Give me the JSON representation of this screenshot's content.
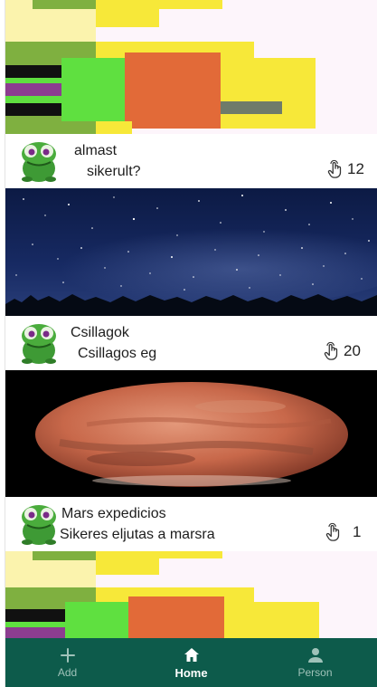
{
  "posts": [
    {
      "title": "almast",
      "body": "sikerult?",
      "likes": "12",
      "image": "abstract-blocks"
    },
    {
      "title": "Csillagok",
      "body": "Csillagos eg",
      "likes": "20",
      "image": "starry-sky"
    },
    {
      "title": "Mars expedicios",
      "body": "Sikeres eljutas a marsra",
      "likes": "1",
      "image": "mars-planet"
    }
  ],
  "nav": {
    "items": [
      {
        "label": "Add",
        "icon": "plus-icon"
      },
      {
        "label": "Home",
        "icon": "home-icon",
        "active": true
      },
      {
        "label": "Person",
        "icon": "person-icon"
      }
    ]
  },
  "colors": {
    "nav_bg": "#0d5b4b",
    "nav_label_inactive": "#9fc2b9",
    "nav_label_active": "#ffffff",
    "page_bg": "#fdf5fb"
  }
}
